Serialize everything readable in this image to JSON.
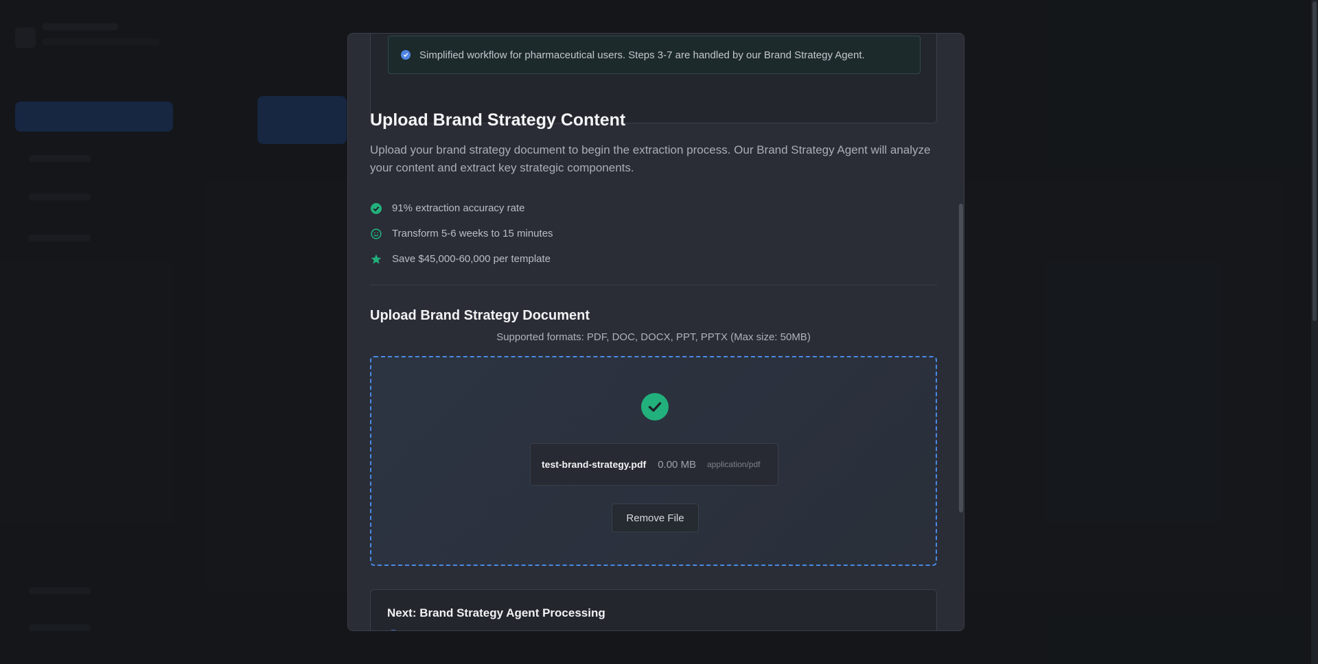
{
  "banner": {
    "text": "Simplified workflow for pharmaceutical users. Steps 3-7 are handled by our Brand Strategy Agent."
  },
  "content": {
    "title": "Upload Brand Strategy Content",
    "description": "Upload your brand strategy document to begin the extraction process. Our Brand Strategy Agent will analyze your content and extract key strategic components.",
    "features": [
      {
        "icon": "check-circle-icon",
        "text": "91% extraction accuracy rate"
      },
      {
        "icon": "smile-icon",
        "text": "Transform 5-6 weeks to 15 minutes"
      },
      {
        "icon": "star-icon",
        "text": "Save $45,000-60,000 per template"
      }
    ]
  },
  "upload": {
    "title": "Upload Brand Strategy Document",
    "formats": "Supported formats: PDF, DOC, DOCX, PPT, PPTX (Max size: 50MB)",
    "file": {
      "name": "test-brand-strategy.pdf",
      "size": "0.00 MB",
      "type": "application/pdf"
    },
    "remove_label": "Remove File"
  },
  "next": {
    "title": "Next: Brand Strategy Agent Processing"
  },
  "colors": {
    "accent": "#4a8ae6",
    "success": "#22b07d"
  }
}
